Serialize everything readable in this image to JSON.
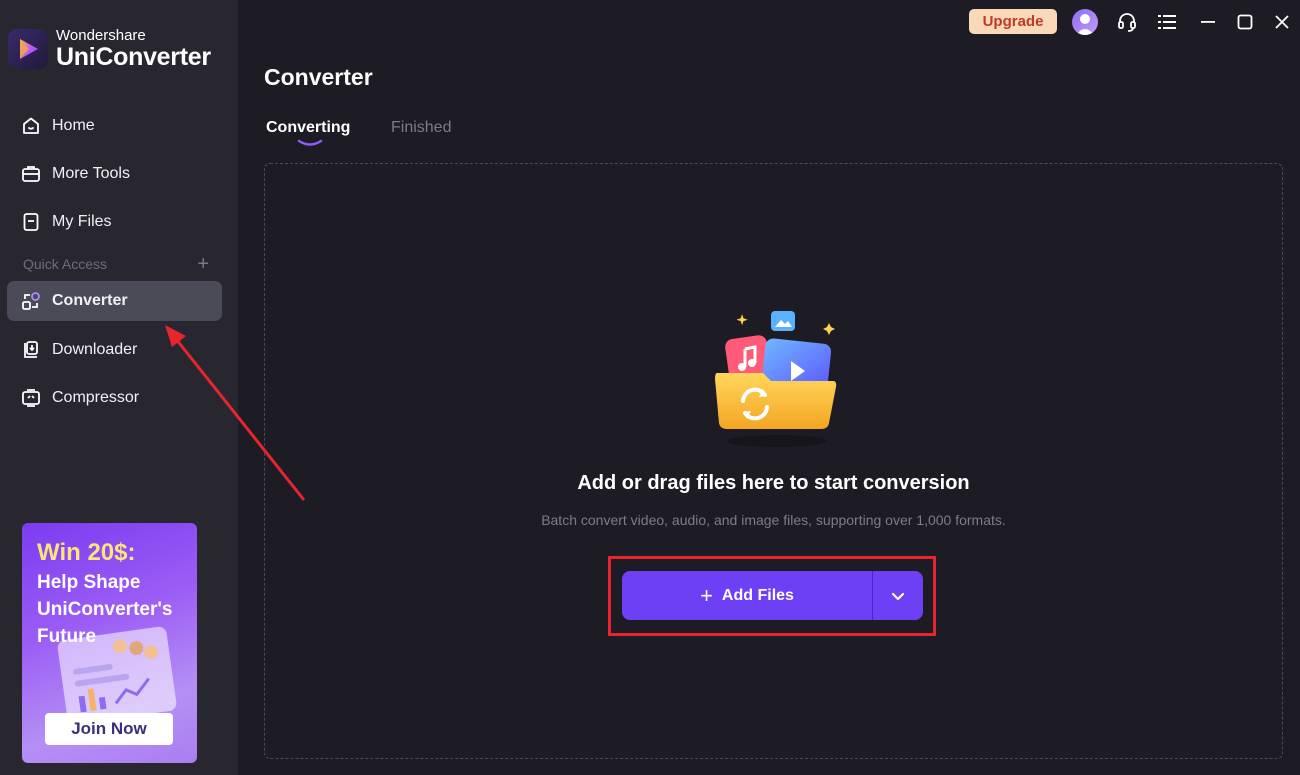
{
  "brand": {
    "subtitle": "Wondershare",
    "title": "UniConverter",
    "logo_icon": "play-logo-icon"
  },
  "sidebar": {
    "items": [
      {
        "label": "Home",
        "icon": "home-icon"
      },
      {
        "label": "More Tools",
        "icon": "toolbox-icon"
      },
      {
        "label": "My Files",
        "icon": "file-icon"
      }
    ],
    "quick_access_label": "Quick Access",
    "quick_items": [
      {
        "label": "Converter",
        "icon": "converter-icon",
        "active": true
      },
      {
        "label": "Downloader",
        "icon": "downloader-icon"
      },
      {
        "label": "Compressor",
        "icon": "compressor-icon"
      }
    ]
  },
  "promo": {
    "title": "Win 20$:",
    "lines": [
      "Help Shape",
      "UniConverter's",
      "Future"
    ],
    "button_label": "Join Now"
  },
  "topbar": {
    "upgrade_label": "Upgrade",
    "icons": [
      "avatar-icon",
      "headset-icon",
      "menu-icon",
      "minimize-icon",
      "maximize-icon",
      "close-icon"
    ]
  },
  "main": {
    "title": "Converter",
    "tabs": [
      {
        "label": "Converting",
        "active": true
      },
      {
        "label": "Finished",
        "active": false
      }
    ],
    "dropzone": {
      "heading": "Add or drag files here to start conversion",
      "subtext": "Batch convert video, audio, and image files, supporting over 1,000 formats.",
      "add_files_label": "Add Files"
    }
  },
  "colors": {
    "accent": "#6d3ff5",
    "sidebar_bg": "#28272f",
    "main_bg": "#1d1c24",
    "highlight": "#e8242e",
    "upgrade_bg": "#f9d9b8"
  }
}
